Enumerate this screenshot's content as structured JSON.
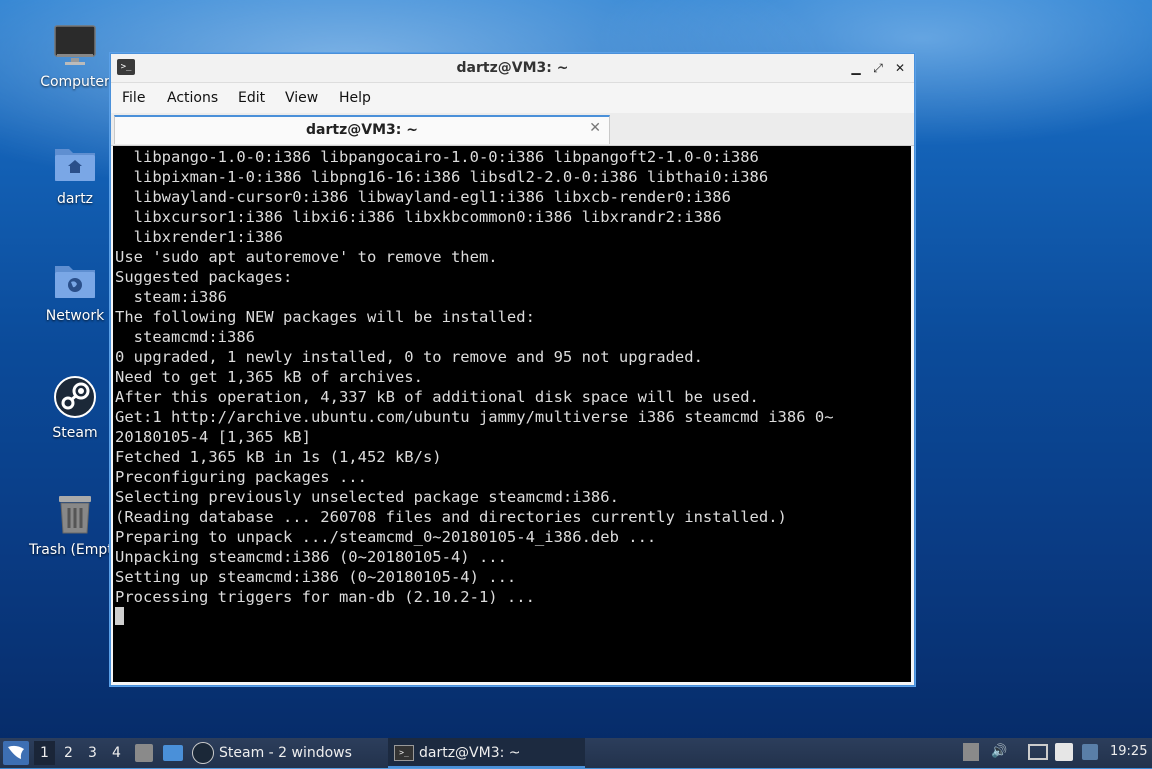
{
  "desktop": {
    "icons": [
      {
        "label": "Computer",
        "icon": "monitor-icon"
      },
      {
        "label": "dartz",
        "icon": "home-folder-icon"
      },
      {
        "label": "Network",
        "icon": "network-folder-icon"
      },
      {
        "label": "Steam",
        "icon": "steam-icon"
      },
      {
        "label": "Trash (Empt",
        "icon": "trash-icon"
      }
    ]
  },
  "window": {
    "title": "dartz@VM3: ~",
    "menu": [
      "File",
      "Actions",
      "Edit",
      "View",
      "Help"
    ],
    "tab_label": "dartz@VM3: ~",
    "terminal_lines": [
      "  libpango-1.0-0:i386 libpangocairo-1.0-0:i386 libpangoft2-1.0-0:i386",
      "  libpixman-1-0:i386 libpng16-16:i386 libsdl2-2.0-0:i386 libthai0:i386",
      "  libwayland-cursor0:i386 libwayland-egl1:i386 libxcb-render0:i386",
      "  libxcursor1:i386 libxi6:i386 libxkbcommon0:i386 libxrandr2:i386",
      "  libxrender1:i386",
      "Use 'sudo apt autoremove' to remove them.",
      "Suggested packages:",
      "  steam:i386",
      "The following NEW packages will be installed:",
      "  steamcmd:i386",
      "0 upgraded, 1 newly installed, 0 to remove and 95 not upgraded.",
      "Need to get 1,365 kB of archives.",
      "After this operation, 4,337 kB of additional disk space will be used.",
      "Get:1 http://archive.ubuntu.com/ubuntu jammy/multiverse i386 steamcmd i386 0~",
      "20180105-4 [1,365 kB]",
      "Fetched 1,365 kB in 1s (1,452 kB/s)",
      "Preconfiguring packages ...",
      "Selecting previously unselected package steamcmd:i386.",
      "(Reading database ... 260708 files and directories currently installed.)",
      "Preparing to unpack .../steamcmd_0~20180105-4_i386.deb ...",
      "Unpacking steamcmd:i386 (0~20180105-4) ...",
      "Setting up steamcmd:i386 (0~20180105-4) ...",
      "Processing triggers for man-db (2.10.2-1) ..."
    ]
  },
  "taskbar": {
    "workspaces": [
      "1",
      "2",
      "3",
      "4"
    ],
    "active_workspace": "1",
    "apps": [
      {
        "label": "Steam - 2 windows",
        "icon": "steam-icon"
      },
      {
        "label": "dartz@VM3: ~",
        "icon": "terminal-icon"
      }
    ],
    "clock": "19:25"
  },
  "colors": {
    "accent": "#4a90d9",
    "terminal_bg": "#000000",
    "terminal_fg": "#dcdcdc",
    "taskbar_bg": "#263752"
  }
}
